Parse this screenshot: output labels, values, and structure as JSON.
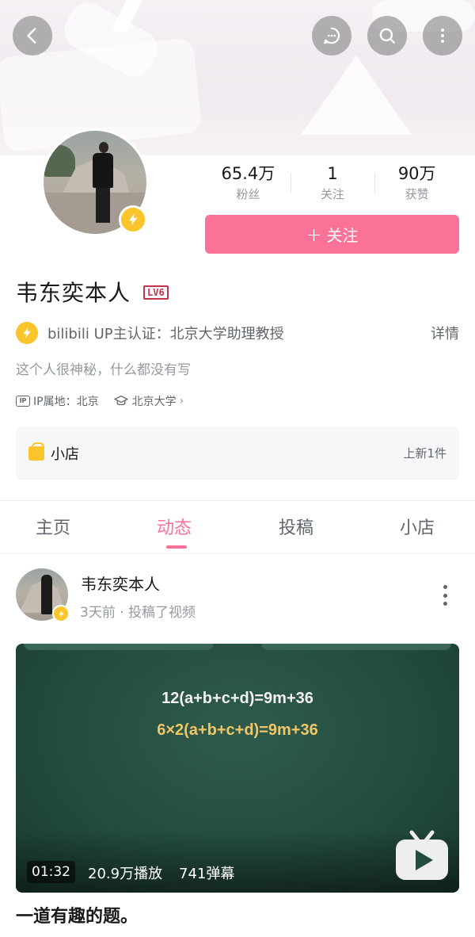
{
  "header": {
    "icons": [
      "back-icon",
      "chat-icon",
      "search-icon",
      "more-vertical-icon"
    ]
  },
  "profile": {
    "name": "韦东奕本人",
    "level": "LV6",
    "stats": [
      {
        "value": "65.4万",
        "label": "粉丝"
      },
      {
        "value": "1",
        "label": "关注"
      },
      {
        "value": "90万",
        "label": "获赞"
      }
    ],
    "follow_label": "关注",
    "certification": "bilibili UP主认证：北京大学助理教授",
    "detail_label": "详情",
    "sign": "这个人很神秘，什么都没有写",
    "ip_badge": "IP",
    "ip_location": "IP属地：北京",
    "school": "北京大学",
    "shop": {
      "label": "小店",
      "update": "上新1件"
    }
  },
  "tabs": [
    {
      "label": "主页",
      "active": false
    },
    {
      "label": "动态",
      "active": true
    },
    {
      "label": "投稿",
      "active": false
    },
    {
      "label": "小店",
      "active": false
    }
  ],
  "feed": {
    "author": "韦东奕本人",
    "time": "3天前 · 投稿了视频",
    "video": {
      "equation_1": "12(a+b+c+d)=9m+36",
      "equation_2": "6×2(a+b+c+d)=9m+36",
      "duration": "01:32",
      "plays": "20.9万播放",
      "danmaku": "741弹幕"
    },
    "title": "一道有趣的题。"
  },
  "colors": {
    "brand_pink": "#fb7299",
    "badge_yellow": "#f9c52a",
    "level_red": "#c5334f",
    "chalkboard": "#244c3f"
  }
}
